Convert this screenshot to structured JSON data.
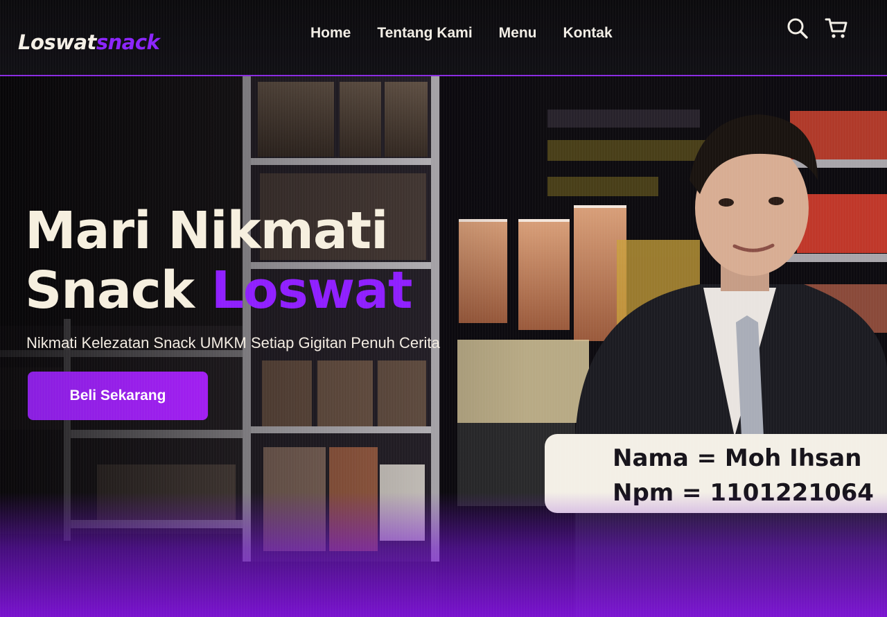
{
  "navbar": {
    "brand_part1": "Loswat",
    "brand_part2": "snack",
    "links": [
      {
        "label": "Home"
      },
      {
        "label": "Tentang Kami"
      },
      {
        "label": "Menu"
      },
      {
        "label": "Kontak"
      }
    ],
    "icons": [
      "search-icon",
      "cart-icon"
    ]
  },
  "hero": {
    "headline_line1": "Mari Nikmati",
    "headline_line2_white": "Snack",
    "headline_line2_accent": "Loswat",
    "tagline": "Nikmati Kelezatan Snack UMKM Setiap Gigitan Penuh Cerita",
    "cta_label": "Beli Sekarang",
    "card_name": "Nama = Moh Ihsan",
    "card_npm": "Npm = 1101221064"
  },
  "colors": {
    "accent": "#8b24ff",
    "cta": "#9b1ff0",
    "text_light": "#f4efe6",
    "background": "#0a090c"
  }
}
